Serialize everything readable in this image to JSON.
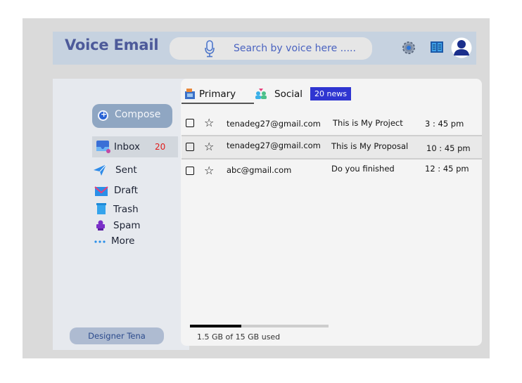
{
  "app": {
    "title": "Voice Email"
  },
  "search": {
    "placeholder": "Search by voice here ....."
  },
  "header": {
    "icons": [
      "microphone-icon",
      "settings-icon",
      "layout-icon",
      "profile-icon"
    ]
  },
  "sidebar": {
    "compose_label": "Compose",
    "items": [
      {
        "label": "Inbox",
        "count": "20",
        "icon": "inbox-icon"
      },
      {
        "label": "Sent",
        "icon": "send-icon"
      },
      {
        "label": "Draft",
        "icon": "mail-icon"
      },
      {
        "label": "Trash",
        "icon": "trash-icon"
      },
      {
        "label": "Spam",
        "icon": "spam-icon"
      },
      {
        "label": "More",
        "icon": "more-icon"
      }
    ],
    "designer": "Designer Tena"
  },
  "tabs": {
    "primary": "Primary",
    "social": "Social",
    "social_badge": "20 news"
  },
  "emails": [
    {
      "sender": "tenadeg27@gmail.com",
      "subject": "This is My Project",
      "time": "3 : 45 pm"
    },
    {
      "sender": "tenadeg27@gmail.com",
      "subject": "This is My Proposal",
      "time": "10 : 45 pm"
    },
    {
      "sender": "abc@gmail.com",
      "subject": "Do you finished",
      "time": "12 : 45 pm"
    }
  ],
  "storage": {
    "text": "1.5 GB of 15 GB used",
    "used_fraction": 0.37
  },
  "colors": {
    "header_bg": "#c6d2e0",
    "accent": "#2f35d1",
    "inbox_count": "#e01b1b",
    "compose_bg": "#8fa6c2"
  }
}
